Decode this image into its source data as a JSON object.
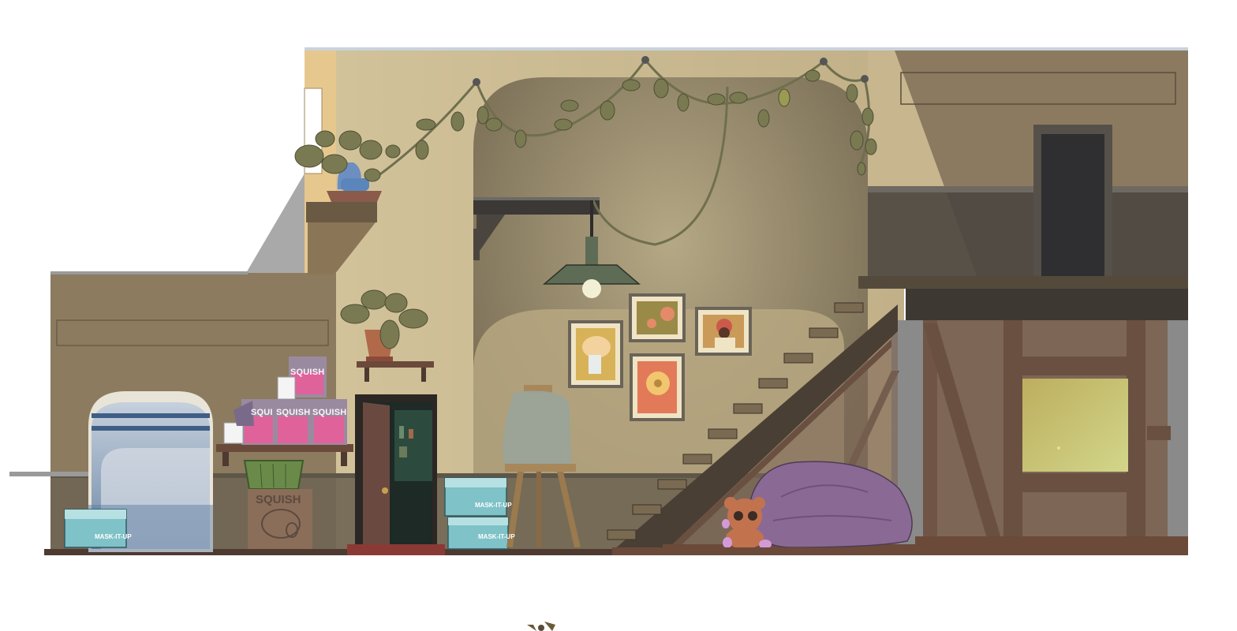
{
  "scene": {
    "name": "storage-room-interior",
    "colors": {
      "wall": "#c7b68e",
      "wall_shadow": "#8a7b5e",
      "wall_dark": "#5f5646",
      "floor": "#6b4a3a",
      "loft_wall": "#3c3a35",
      "bean_bag": "#8a6a94",
      "vine": "#6f6f4e",
      "leaf": "#7a7a52",
      "squish_pink": "#e0629a",
      "mask_teal": "#6fb7bd"
    }
  },
  "products": {
    "squish_label": "SQUISH",
    "mask_label": "MASK-IT-UP"
  },
  "fixtures": {
    "pendant_lamp": "pendant-lamp",
    "staircase": "staircase",
    "easel": "easel-with-covered-canvas",
    "bean_bag": "bean-bag-chair",
    "teddy_bear": "teddy-bear",
    "doorway": "open-door",
    "window": "arched-window",
    "loft_window": "loft-window"
  },
  "frames": [
    "sunflower-vase-frame",
    "rose-frame",
    "portrait-frame",
    "flower-frame"
  ]
}
